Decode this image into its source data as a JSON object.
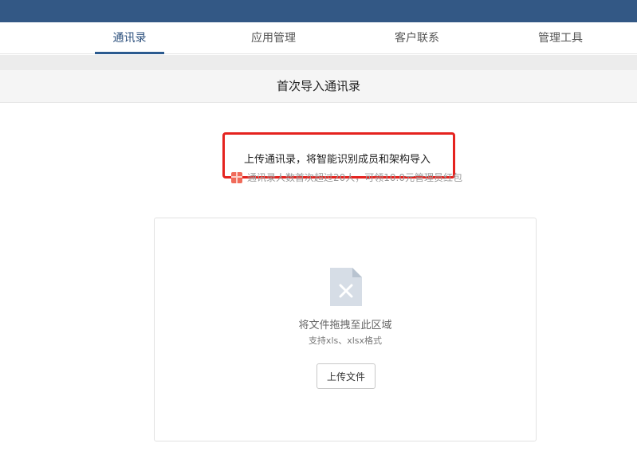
{
  "nav": {
    "items": [
      {
        "label": "通讯录",
        "active": true
      },
      {
        "label": "应用管理",
        "active": false
      },
      {
        "label": "客户联系",
        "active": false
      },
      {
        "label": "管理工具",
        "active": false
      }
    ]
  },
  "page": {
    "title": "首次导入通讯录"
  },
  "intro": {
    "main_text": "上传通讯录，将智能识别成员和架构导入",
    "reward_text": "通讯录人数首次超过20人，可领10.0元管理员红包",
    "reward_icon": "red-envelope-icon"
  },
  "upload": {
    "file_icon": "file-x-icon",
    "drop_text": "将文件拖拽至此区域",
    "formats_text": "支持xls、xlsx格式",
    "button_label": "上传文件"
  },
  "colors": {
    "topbar": "#335885",
    "nav_active": "#2b5a8f",
    "highlight": "#e5231f",
    "reward_icon": "#f06b5a"
  }
}
